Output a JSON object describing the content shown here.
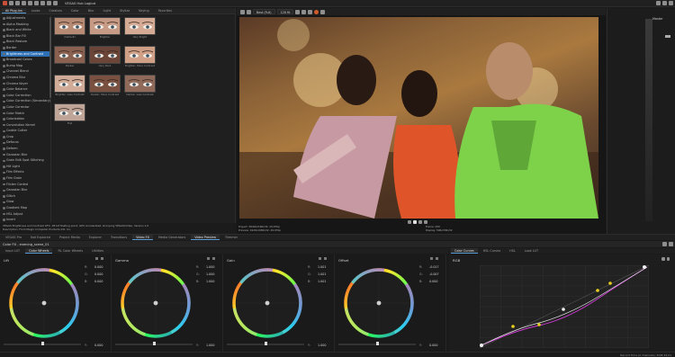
{
  "app_title": "VEGAS Hub Logical",
  "toolbar": {
    "project_button": "Project",
    "render_button": "Render",
    "scale_field": "128 fit",
    "quality_field": "Best (Full)"
  },
  "left_tabs": [
    "All Plug-Ins",
    "Looks",
    "Creators",
    "Color",
    "Blur",
    "Light",
    "Stylize",
    "Keying",
    "Favorites"
  ],
  "effects": [
    "Adjustments",
    "Alpha Masking",
    "Black and White",
    "Black Bar Fill",
    "Black Restore",
    "Border",
    "Brightness and Contrast",
    "Broadcast Colors",
    "Bump Map",
    "Channel Blend",
    "Chroma Blur",
    "Chroma Keyer",
    "Color Balance",
    "Color Correction",
    "Color Correction (Secondary)",
    "Color Corrector",
    "Color Match",
    "Colorization",
    "Convolution Kernel",
    "Cookie Cutter",
    "Crop",
    "Defocus",
    "Deform",
    "Gaussian Blur",
    "Grain Edit Spot Stitching",
    "Hill Light",
    "Film Effects",
    "Film Grain",
    "Flicker Control",
    "Gaussian Blur",
    "Glitch",
    "Glow",
    "Gradient Map",
    "HSL Adjust",
    "Invert"
  ],
  "thumbnails": [
    {
      "caption": "(Default)"
    },
    {
      "caption": "Brighter"
    },
    {
      "caption": "Very Bright"
    },
    {
      "caption": "Darker"
    },
    {
      "caption": "Very Dark"
    },
    {
      "caption": "Brighter, More Contrast"
    },
    {
      "caption": "Brighter, Less Contrast"
    },
    {
      "caption": "Darker, More Contrast"
    },
    {
      "caption": "Darker, Less Contrast"
    },
    {
      "caption": "Flat"
    }
  ],
  "status_text": "VEGAS Brightness and Contrast OFX, 1B bit floating point, GPU Accelerated, Grouping VEGAS\\Video, Version 1.0",
  "status_text2": "Description: From Magix Computer Products Intl. Co.",
  "bottom_tabs_left": [
    "VEGAS Pro",
    "Not Explored",
    "Project Media",
    "Explorer",
    "Transitions",
    "Video FX",
    "Media Generators"
  ],
  "preview_tabs": [
    "Video Preview",
    "Trimmer"
  ],
  "preview_info": {
    "project": "Project:  3840x2160x32, 29.970p",
    "preview": "Preview:  1920x1080x32, 29.970p",
    "display": "Display:  596x336x32",
    "frame": "Frame:   200"
  },
  "timeline_label": "Color FX - evening_scene_01",
  "color_tabs": [
    "Input LUT",
    "Color Wheels",
    "RL Color Wheels",
    "Utilities"
  ],
  "curve_tabs": [
    "Color Curves",
    "HSL Curves",
    "HSL",
    "Look LUT"
  ],
  "wheels": [
    {
      "name": "Lift",
      "r": "0.000",
      "g": "0.000",
      "b": "0.000",
      "y": "0.000"
    },
    {
      "name": "Gamma",
      "r": "1.000",
      "g": "1.000",
      "b": "1.000",
      "y": "1.000"
    },
    {
      "name": "Gain",
      "r": "1.001",
      "g": "1.001",
      "b": "1.001",
      "y": "1.000"
    },
    {
      "name": "Offset",
      "r": "-0.017",
      "g": "-0.007",
      "b": "0.000",
      "y": "0.000"
    }
  ],
  "curve_label": "RGB",
  "meter_label": "Master",
  "render_time": "Record Time (2 channels): 8:08:34:21"
}
